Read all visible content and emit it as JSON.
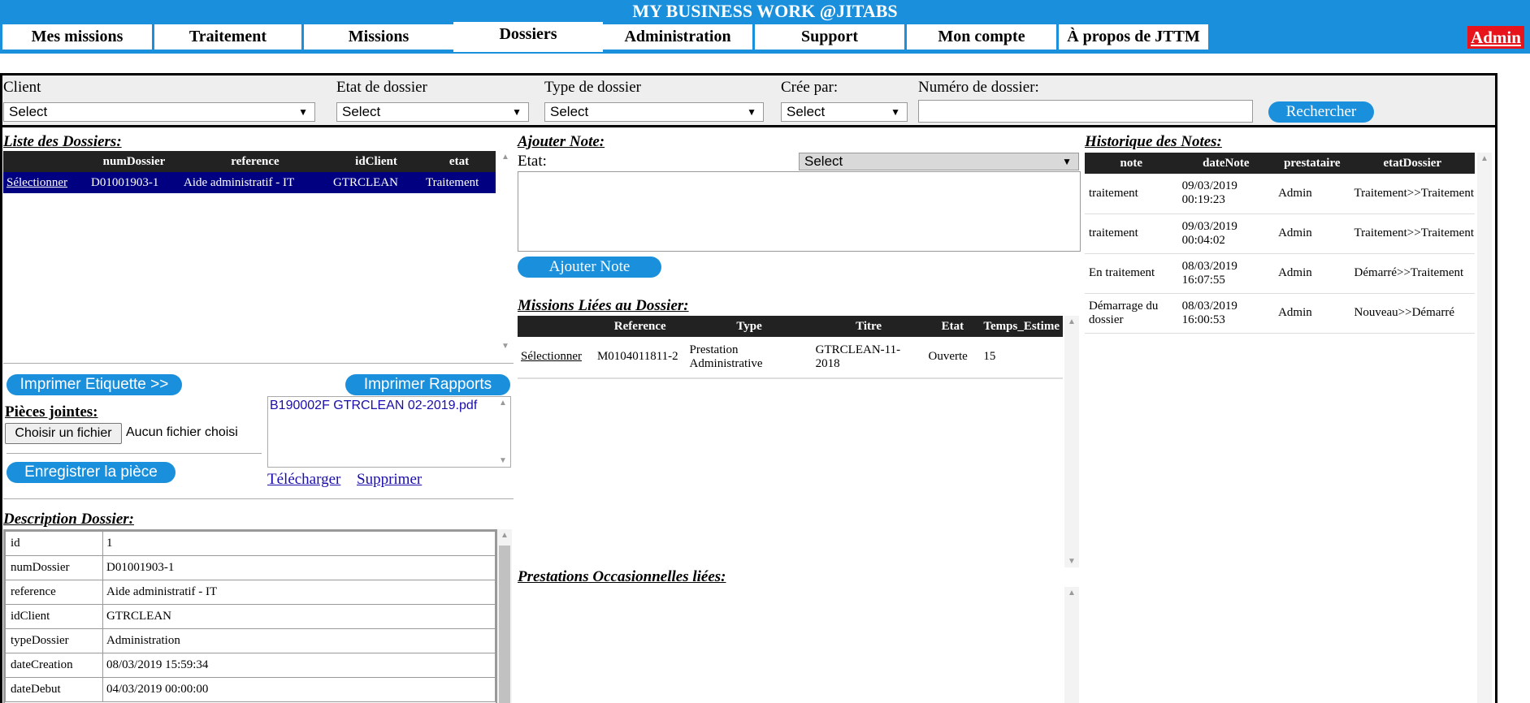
{
  "app": {
    "title": "MY BUSINESS WORK @JITABS",
    "admin_label": "Admin"
  },
  "nav": {
    "tabs": [
      {
        "label": "Mes missions"
      },
      {
        "label": "Traitement"
      },
      {
        "label": "Missions"
      },
      {
        "label": "Dossiers",
        "active": true
      },
      {
        "label": "Administration"
      },
      {
        "label": "Support"
      },
      {
        "label": "Mon compte"
      },
      {
        "label": "À propos de JTTM"
      }
    ]
  },
  "filters": {
    "client_label": "Client",
    "etat_label": "Etat de dossier",
    "type_label": "Type de dossier",
    "cree_label": "Crée par:",
    "numero_label": "Numéro de dossier:",
    "select_value": "Select",
    "search_button": "Rechercher"
  },
  "liste": {
    "title": "Liste des Dossiers:",
    "headers": [
      "",
      "numDossier",
      "reference",
      "idClient",
      "etat"
    ],
    "row": {
      "select": "Sélectionner",
      "numDossier": "D01001903-1",
      "reference": "Aide administratif - IT",
      "idClient": "GTRCLEAN",
      "etat": "Traitement"
    }
  },
  "actions": {
    "imprimer_etiquette": "Imprimer Etiquette >>",
    "imprimer_rapports": "Imprimer Rapports",
    "pieces_label": "Pièces jointes:",
    "choose_file": "Choisir un fichier",
    "no_file": "Aucun fichier choisi",
    "enregistrer": "Enregistrer la pièce",
    "attachment": "B190002F GTRCLEAN 02-2019.pdf",
    "telecharger": "Télécharger",
    "supprimer": "Supprimer"
  },
  "description": {
    "title": "Description Dossier:",
    "rows": [
      {
        "key": "id",
        "value": "1"
      },
      {
        "key": "numDossier",
        "value": "D01001903-1"
      },
      {
        "key": "reference",
        "value": "Aide administratif - IT"
      },
      {
        "key": "idClient",
        "value": "GTRCLEAN"
      },
      {
        "key": "typeDossier",
        "value": "Administration"
      },
      {
        "key": "dateCreation",
        "value": "08/03/2019 15:59:34"
      },
      {
        "key": "dateDebut",
        "value": "04/03/2019 00:00:00"
      }
    ]
  },
  "note": {
    "title": "Ajouter Note:",
    "etat_label": "Etat:",
    "etat_value": "Select",
    "button": "Ajouter Note"
  },
  "missions": {
    "title": "Missions Liées au Dossier:",
    "headers": [
      "",
      "Reference",
      "Type",
      "Titre",
      "Etat",
      "Temps_Estime"
    ],
    "row": {
      "select": "Sélectionner",
      "reference": "M0104011811-2",
      "type": "Prestation Administrative",
      "titre": "GTRCLEAN-11-2018",
      "etat": "Ouverte",
      "temps": "15"
    }
  },
  "prestations": {
    "title": "Prestations Occasionnelles liées:"
  },
  "historique": {
    "title": "Historique des Notes:",
    "headers": [
      "note",
      "dateNote",
      "prestataire",
      "etatDossier"
    ],
    "rows": [
      {
        "note": "traitement",
        "date": "09/03/2019 00:19:23",
        "prestataire": "Admin",
        "etat": "Traitement>>Traitement"
      },
      {
        "note": "traitement",
        "date": "09/03/2019 00:04:02",
        "prestataire": "Admin",
        "etat": "Traitement>>Traitement"
      },
      {
        "note": "En traitement",
        "date": "08/03/2019 16:07:55",
        "prestataire": "Admin",
        "etat": "Démarré>>Traitement"
      },
      {
        "note": "Démarrage du dossier",
        "date": "08/03/2019 16:00:53",
        "prestataire": "Admin",
        "etat": "Nouveau>>Démarré"
      }
    ]
  }
}
